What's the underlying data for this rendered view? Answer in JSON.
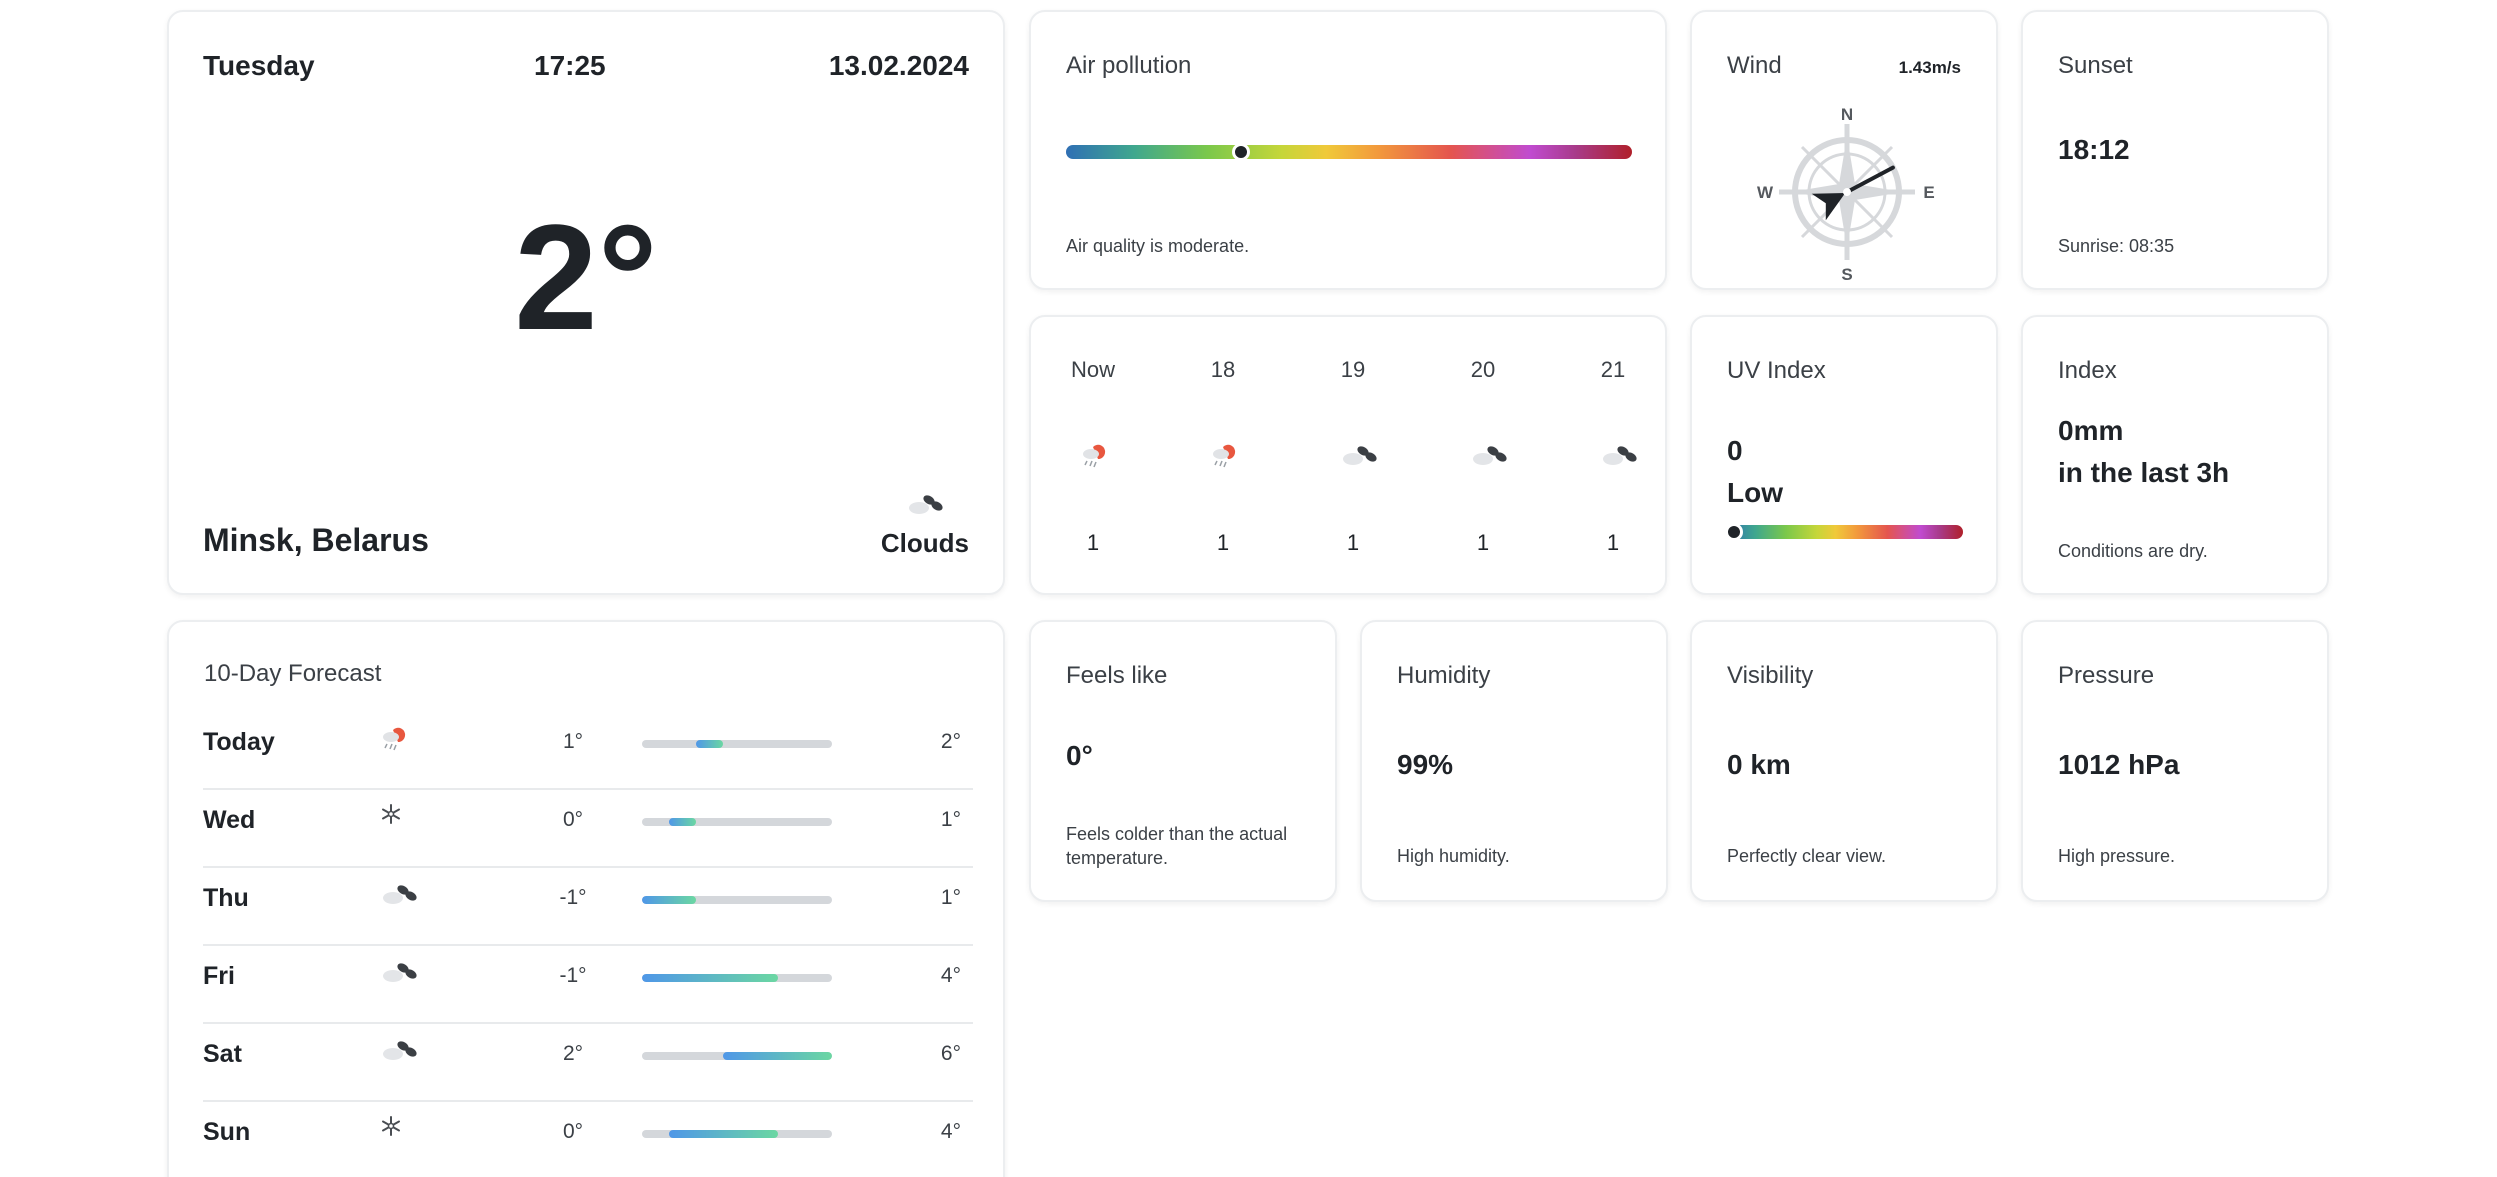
{
  "main": {
    "day": "Tuesday",
    "time": "17:25",
    "date": "13.02.2024",
    "temperature": "2°",
    "location": "Minsk, Belarus",
    "condition": "Clouds",
    "condition_icon": "clouds-icon"
  },
  "air": {
    "title": "Air pollution",
    "level_fraction": 0.31,
    "description": "Air quality is moderate."
  },
  "wind": {
    "title": "Wind",
    "speed": "1.43m/s",
    "north": "N",
    "south": "S",
    "east": "E",
    "west": "W",
    "direction_deg": 62
  },
  "sunset": {
    "title": "Sunset",
    "time": "18:12",
    "sunrise": "Sunrise: 08:35"
  },
  "hourly": [
    {
      "label": "Now",
      "icon": "rain-sun-icon",
      "value": "1"
    },
    {
      "label": "18",
      "icon": "rain-sun-icon",
      "value": "1"
    },
    {
      "label": "19",
      "icon": "clouds-icon",
      "value": "1"
    },
    {
      "label": "20",
      "icon": "clouds-icon",
      "value": "1"
    },
    {
      "label": "21",
      "icon": "clouds-icon",
      "value": "1"
    }
  ],
  "uv": {
    "title": "UV Index",
    "value": "0",
    "level": "Low",
    "level_fraction": 0.0
  },
  "precip": {
    "title": "Index",
    "amount": "0mm",
    "period": "in the last 3h",
    "description": "Conditions are dry."
  },
  "feels": {
    "title": "Feels like",
    "value": "0°",
    "description": "Feels colder than the actual temperature."
  },
  "humidity": {
    "title": "Humidity",
    "value": "99%",
    "description": "High humidity."
  },
  "visibility": {
    "title": "Visibility",
    "value": "0 km",
    "description": "Perfectly clear view."
  },
  "pressure": {
    "title": "Pressure",
    "value": "1012 hPa",
    "description": "High pressure."
  },
  "forecast": {
    "title": "10-Day Forecast",
    "range_min": -1,
    "range_max": 6,
    "days": [
      {
        "day": "Today",
        "icon": "rain-sun-icon",
        "min": "1°",
        "max": "2°",
        "min_val": 1,
        "max_val": 2
      },
      {
        "day": "Wed",
        "icon": "snowflake-icon",
        "min": "0°",
        "max": "1°",
        "min_val": 0,
        "max_val": 1
      },
      {
        "day": "Thu",
        "icon": "clouds-icon",
        "min": "-1°",
        "max": "1°",
        "min_val": -1,
        "max_val": 1
      },
      {
        "day": "Fri",
        "icon": "clouds-icon",
        "min": "-1°",
        "max": "4°",
        "min_val": -1,
        "max_val": 4
      },
      {
        "day": "Sat",
        "icon": "clouds-icon",
        "min": "2°",
        "max": "6°",
        "min_val": 2,
        "max_val": 6
      },
      {
        "day": "Sun",
        "icon": "snowflake-icon",
        "min": "0°",
        "max": "4°",
        "min_val": 0,
        "max_val": 4
      }
    ]
  }
}
